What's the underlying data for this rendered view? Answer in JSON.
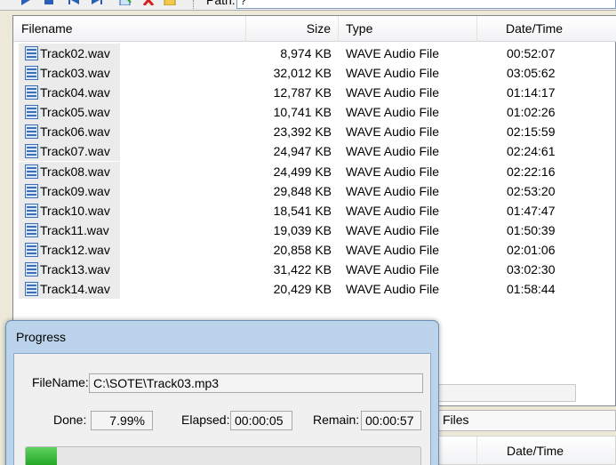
{
  "toolbar": {
    "path_label": "Path:",
    "path_value": "?"
  },
  "filelist": {
    "columns": {
      "filename": "Filename",
      "size": "Size",
      "type": "Type",
      "datetime": "Date/Time"
    },
    "rows": [
      {
        "name": "Track02.wav",
        "size": "8,974 KB",
        "type": "WAVE Audio File",
        "time": "00:52:07"
      },
      {
        "name": "Track03.wav",
        "size": "32,012 KB",
        "type": "WAVE Audio File",
        "time": "03:05:62"
      },
      {
        "name": "Track04.wav",
        "size": "12,787 KB",
        "type": "WAVE Audio File",
        "time": "01:14:17"
      },
      {
        "name": "Track05.wav",
        "size": "10,741 KB",
        "type": "WAVE Audio File",
        "time": "01:02:26"
      },
      {
        "name": "Track06.wav",
        "size": "23,392 KB",
        "type": "WAVE Audio File",
        "time": "02:15:59"
      },
      {
        "name": "Track07.wav",
        "size": "24,947 KB",
        "type": "WAVE Audio File",
        "time": "02:24:61"
      },
      {
        "name": "Track08.wav",
        "size": "24,499 KB",
        "type": "WAVE Audio File",
        "time": "02:22:16"
      },
      {
        "name": "Track09.wav",
        "size": "29,848 KB",
        "type": "WAVE Audio File",
        "time": "02:53:20"
      },
      {
        "name": "Track10.wav",
        "size": "18,541 KB",
        "type": "WAVE Audio File",
        "time": "01:47:47"
      },
      {
        "name": "Track11.wav",
        "size": "19,039 KB",
        "type": "WAVE Audio File",
        "time": "01:50:39"
      },
      {
        "name": "Track12.wav",
        "size": "20,858 KB",
        "type": "WAVE Audio File",
        "time": "02:01:06"
      },
      {
        "name": "Track13.wav",
        "size": "31,422 KB",
        "type": "WAVE Audio File",
        "time": "03:02:30"
      },
      {
        "name": "Track14.wav",
        "size": "20,429 KB",
        "type": "WAVE Audio File",
        "time": "01:58:44"
      }
    ]
  },
  "lower": {
    "tab_label": "Files",
    "datetime_header": "Date/Time"
  },
  "progress_dialog": {
    "title": "Progress",
    "filename_label": "FileName:",
    "filename_value": "C:\\SOTE\\Track03.mp3",
    "done_label": "Done:",
    "done_value": "7.99%",
    "elapsed_label": "Elapsed:",
    "elapsed_value": "00:00:05",
    "remain_label": "Remain:",
    "remain_value": "00:00:57",
    "progress_fraction": 0.0799
  },
  "icons": {
    "toolbar": [
      "play-icon",
      "stop-icon",
      "previous-icon",
      "next-icon",
      "add-files-icon",
      "delete-icon",
      "folder-icon"
    ],
    "file": "wave-file-icon"
  },
  "colors": {
    "progress": "#2fb52f",
    "dialog_frame": "#bcd3ec"
  }
}
